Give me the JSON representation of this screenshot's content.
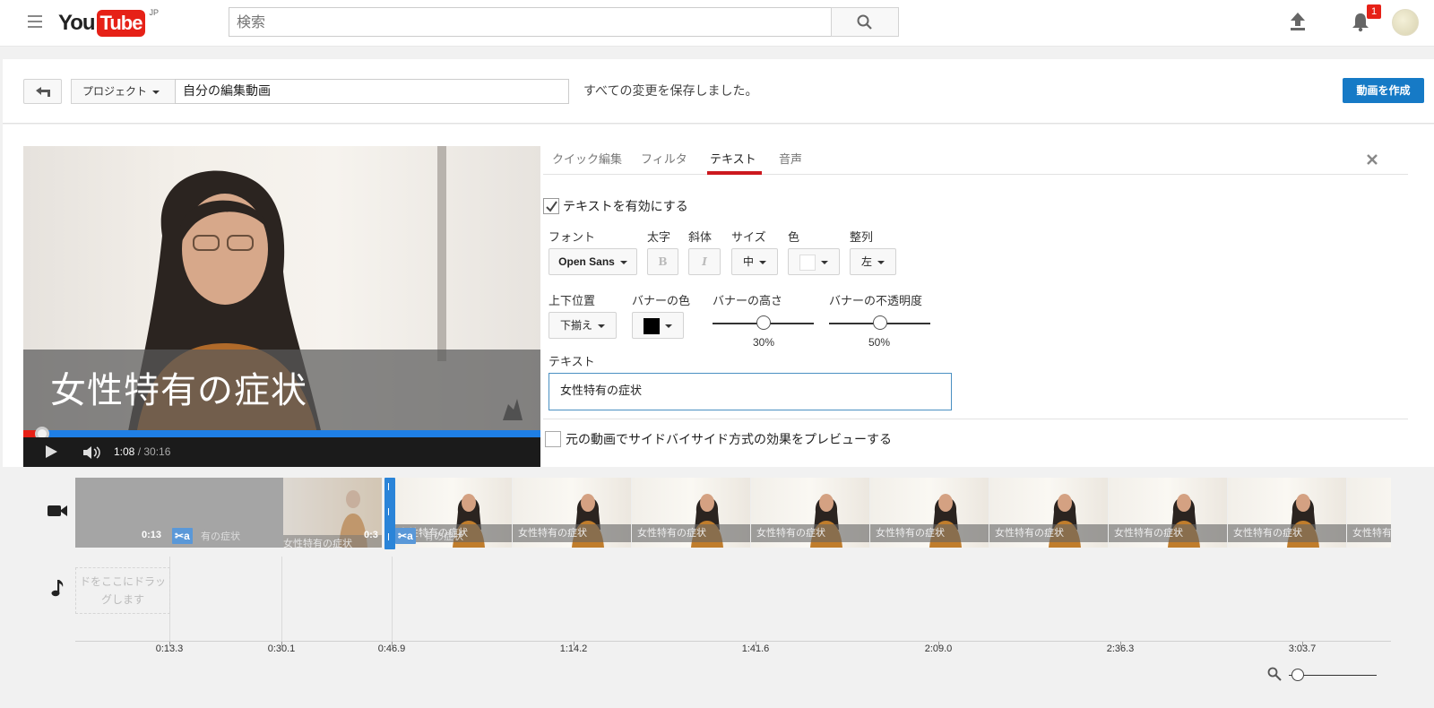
{
  "masthead": {
    "logo_you": "You",
    "logo_tube": "Tube",
    "logo_region": "JP",
    "search_placeholder": "検索",
    "notification_count": "1"
  },
  "project": {
    "dropdown_label": "プロジェクト",
    "name": "自分の編集動画",
    "save_status": "すべての変更を保存しました。",
    "create_label": "動画を作成"
  },
  "video": {
    "banner_text": "女性特有の症状",
    "current_time": "1:08",
    "duration": "/ 30:16",
    "progress_fraction": 0.037
  },
  "editor": {
    "tabs": [
      "クイック編集",
      "フィルタ",
      "テキスト",
      "音声"
    ],
    "active_tab": "テキスト",
    "enable_text": "テキストを有効にする",
    "labels": {
      "font": "フォント",
      "bold": "太字",
      "italic": "斜体",
      "size": "サイズ",
      "color": "色",
      "align": "整列",
      "position": "上下位置",
      "banner_color": "バナーの色",
      "banner_height": "バナーの高さ",
      "banner_opacity": "バナーの不透明度",
      "text": "テキスト"
    },
    "font_value": "Open Sans",
    "bold_glyph": "B",
    "italic_glyph": "I",
    "size_value": "中",
    "align_value": "左",
    "position_value": "下揃え",
    "banner_color_value": "#000000",
    "text_color_value": "#ffffff",
    "banner_height_pct": "30%",
    "banner_height_value": 0.5,
    "banner_opacity_pct": "50%",
    "banner_opacity_value": 0.5,
    "text_value": "女性特有の症状",
    "side_by_side": "元の動画でサイドバイサイド方式の効果をプレビューする"
  },
  "timeline": {
    "clip_time_1": "0:13",
    "clip_time_2": "0:3",
    "fx_glyph": "a",
    "clip_label": "女性特有の症状",
    "clip_label_partial": "有の症状",
    "audio_hint_line1": "ドをここにドラッ",
    "audio_hint_line2": "グします",
    "ruler_ticks": [
      "0:13.3",
      "0:30.1",
      "0:46.9",
      "1:14.2",
      "1:41.6",
      "2:09.0",
      "2:36.3",
      "3:03.7"
    ]
  },
  "colors": {
    "brand_red": "#e62117",
    "primary_blue": "#167ac6",
    "progress_blue": "#1f7fe5",
    "tab_underline": "#cc181e"
  }
}
